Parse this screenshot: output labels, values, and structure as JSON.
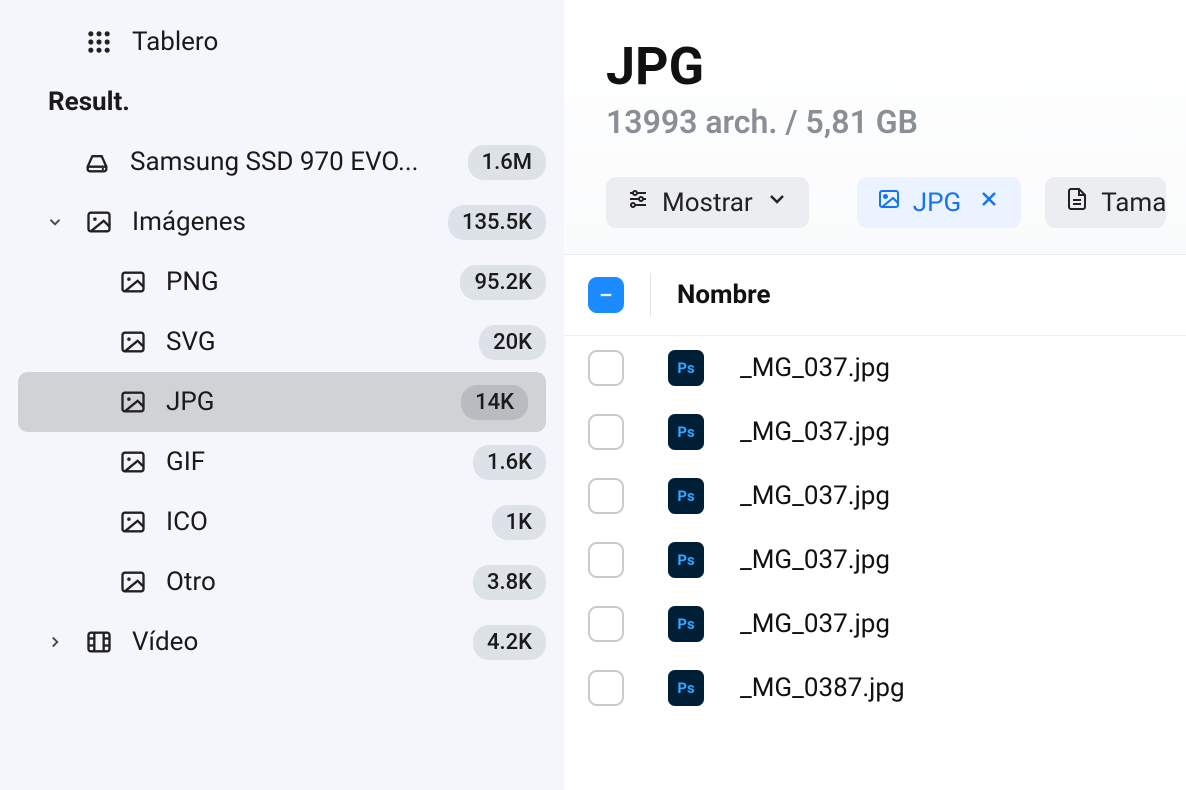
{
  "sidebar": {
    "heading": "Result.",
    "rows": [
      {
        "id": "tablero",
        "label": "Tablero",
        "icon": "grid",
        "level": 1,
        "chevron": null,
        "badge": null
      },
      {
        "id": "heading",
        "label": "Result.",
        "heading": true
      },
      {
        "id": "ssd",
        "label": "Samsung SSD 970 EVO...",
        "icon": "drive",
        "level": 2,
        "chevron": null,
        "badge": "1.6M"
      },
      {
        "id": "imagenes",
        "label": "Imágenes",
        "icon": "image",
        "level": 1,
        "chevron": "down",
        "badge": "135.5K"
      },
      {
        "id": "png",
        "label": "PNG",
        "icon": "image",
        "level": 3,
        "chevron": null,
        "badge": "95.2K"
      },
      {
        "id": "svg",
        "label": "SVG",
        "icon": "image",
        "level": 3,
        "chevron": null,
        "badge": "20K"
      },
      {
        "id": "jpg",
        "label": "JPG",
        "icon": "image",
        "level": 3,
        "chevron": null,
        "badge": "14K",
        "selected": true
      },
      {
        "id": "gif",
        "label": "GIF",
        "icon": "image",
        "level": 3,
        "chevron": null,
        "badge": "1.6K"
      },
      {
        "id": "ico",
        "label": "ICO",
        "icon": "image",
        "level": 3,
        "chevron": null,
        "badge": "1K"
      },
      {
        "id": "otro",
        "label": "Otro",
        "icon": "image",
        "level": 3,
        "chevron": null,
        "badge": "3.8K"
      },
      {
        "id": "video",
        "label": "Vídeo",
        "icon": "film",
        "level": 1,
        "chevron": "right",
        "badge": "4.2K"
      }
    ]
  },
  "main": {
    "title": "JPG",
    "subtitle": "13993 arch. / 5,81 GB",
    "toolbar": {
      "show_label": "Mostrar",
      "filter_label": "JPG",
      "size_label": "Tama"
    },
    "table": {
      "column_name": "Nombre",
      "files": [
        {
          "name": "_MG_037.jpg"
        },
        {
          "name": "_MG_037.jpg"
        },
        {
          "name": "_MG_037.jpg"
        },
        {
          "name": "_MG_037.jpg"
        },
        {
          "name": "_MG_037.jpg"
        },
        {
          "name": "_MG_0387.jpg"
        }
      ]
    }
  }
}
